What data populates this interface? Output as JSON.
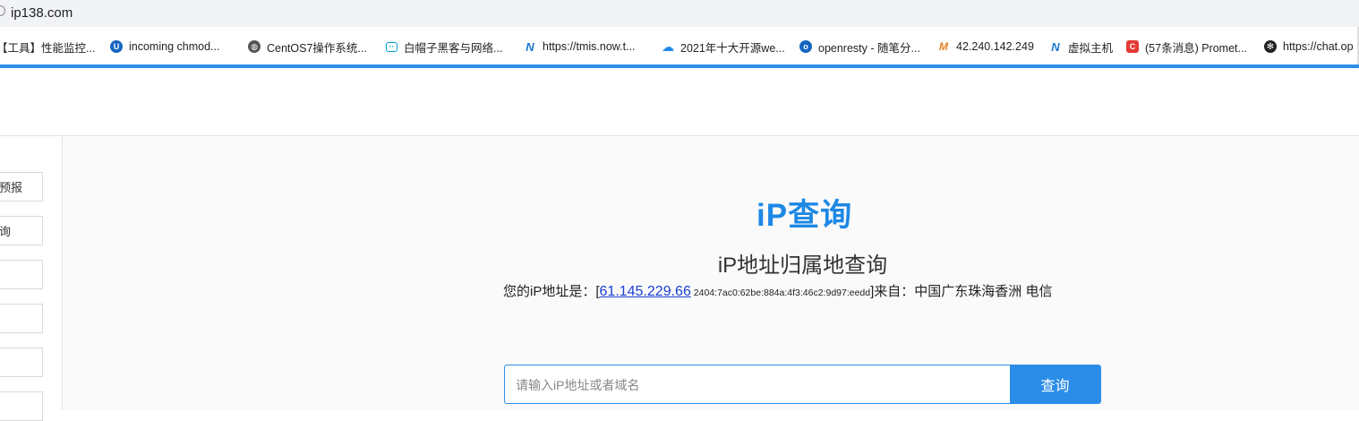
{
  "browser": {
    "url": "ip138.com"
  },
  "bookmarks": [
    {
      "label": "【工具】性能监控...",
      "icon": "folder-icon",
      "color": "#2f8fe6"
    },
    {
      "label": "incoming chmod...",
      "icon": "u-logo-icon",
      "color": "#1565c0"
    },
    {
      "label": "CentOS7操作系统...",
      "icon": "globe-icon",
      "color": "#555555"
    },
    {
      "label": "白帽子黑客与网络...",
      "icon": "bilibili-icon",
      "color": "#00a1d6"
    },
    {
      "label": "https://tmis.now.t...",
      "icon": "n-logo-icon",
      "color": "#1976d2"
    },
    {
      "label": "2021年十大开源we...",
      "icon": "cloud-icon",
      "color": "#1e88e5"
    },
    {
      "label": "openresty - 随笔分...",
      "icon": "o-logo-icon",
      "color": "#1565c0"
    },
    {
      "label": "42.240.142.249",
      "icon": "m-logo-icon",
      "color": "#e67e22"
    },
    {
      "label": "虚拟主机",
      "icon": "n-logo-icon",
      "color": "#1976d2"
    },
    {
      "label": "(57条消息) Promet...",
      "icon": "c-logo-icon",
      "color": "#e53935"
    },
    {
      "label": "https://chat.op",
      "icon": "openai-icon",
      "color": "#222222"
    }
  ],
  "sidebar": {
    "items": [
      {
        "label": "预报"
      },
      {
        "label": "询"
      },
      {
        "label": ""
      },
      {
        "label": ""
      },
      {
        "label": ""
      },
      {
        "label": ""
      }
    ]
  },
  "main": {
    "logo": "iP查询",
    "subtitle": "iP地址归属地查询",
    "ip_prefix": "您的iP地址是：[",
    "ipv4": "61.145.229.66",
    "ipv6": " 2404:7ac0:62be:884a:4f3:46c2:9d97:eedd",
    "ip_suffix": "]来自：中国广东珠海香洲 电信",
    "search_placeholder": "请输入iP地址或者域名",
    "search_button": "查询"
  },
  "colors": {
    "accent": "#2b8de8",
    "logo": "#1e88e5",
    "link": "#1a3fd6"
  }
}
